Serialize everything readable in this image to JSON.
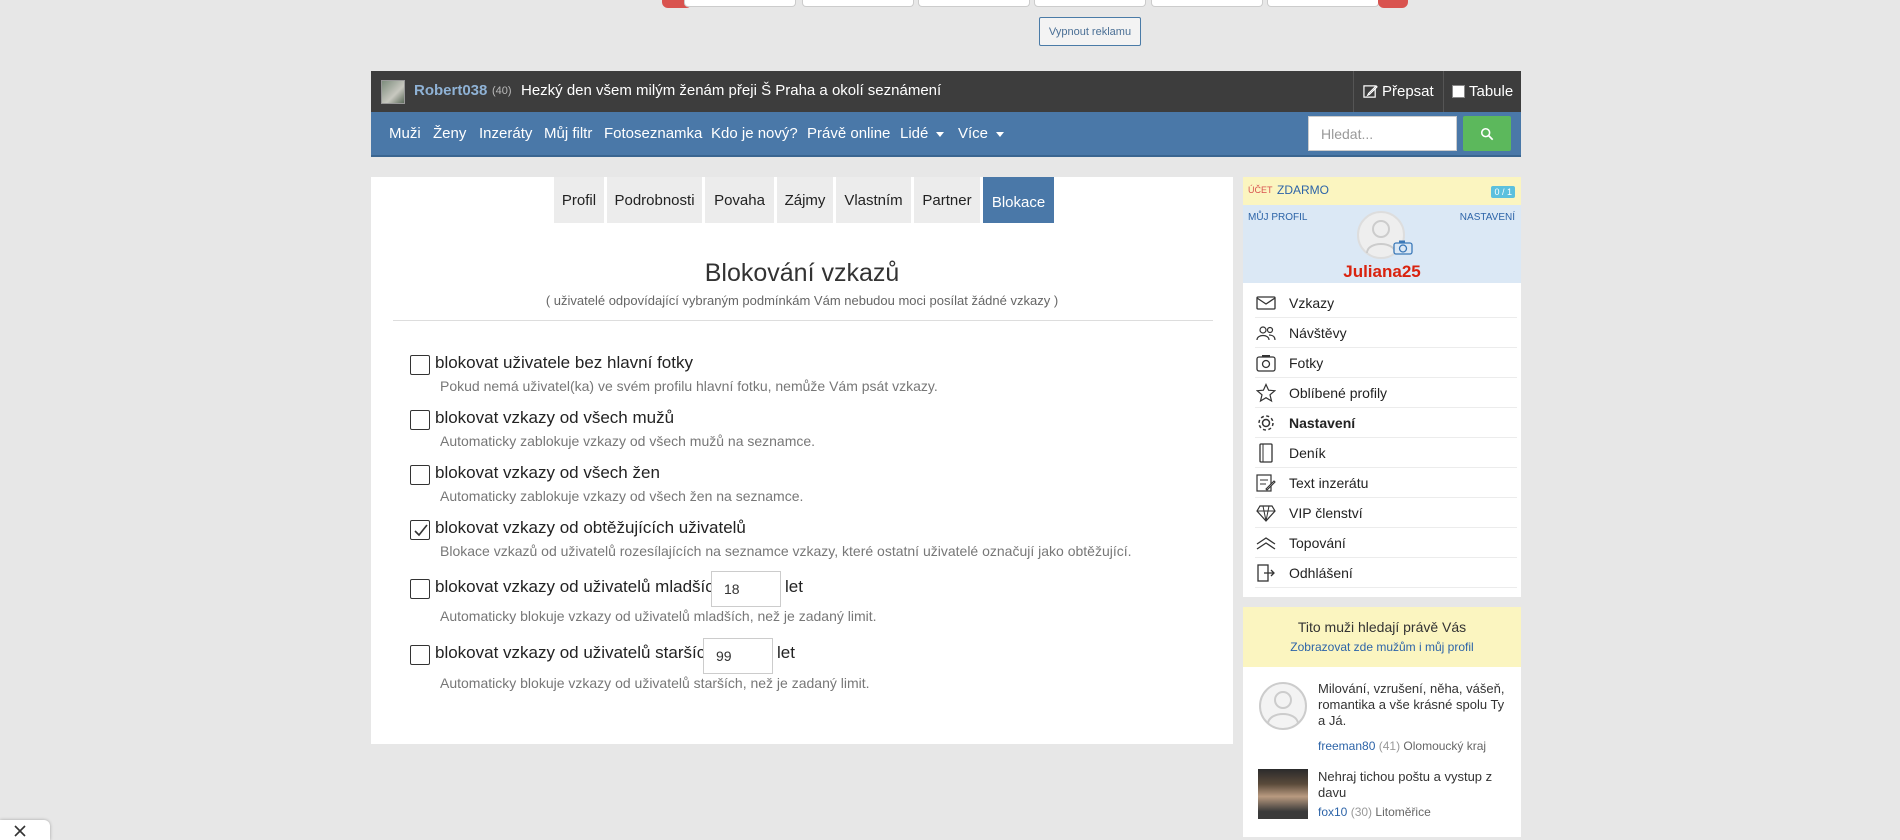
{
  "ad": {
    "button_label": "Vypnout reklamu"
  },
  "header": {
    "username": "Robert038",
    "age": "(40)",
    "status_message": "Hezký den všem milým ženám přeji Š Praha a okolí seznámení",
    "rewrite_label": "Přepsat",
    "board_label": "Tabule"
  },
  "nav": {
    "items": [
      "Muži",
      "Ženy",
      "Inzeráty",
      "Můj filtr",
      "Fotoseznamka",
      "Kdo je nový?",
      "Právě online",
      "Lidé",
      "Více"
    ],
    "search_placeholder": "Hledat..."
  },
  "tabs": [
    "Profil",
    "Podrobnosti",
    "Povaha",
    "Zájmy",
    "Vlastním",
    "Partner",
    "Blokace"
  ],
  "active_tab": "Blokace",
  "page": {
    "title": "Blokování vzkazů",
    "subtitle": "( uživatelé odpovídající vybraným podmínkám Vám nebudou moci posílat žádné vzkazy )"
  },
  "options": [
    {
      "label": "blokovat uživatele bez hlavní fotky",
      "desc": "Pokud nemá uživatel(ka) ve svém profilu hlavní fotku, nemůže Vám psát vzkazy.",
      "checked": false
    },
    {
      "label": "blokovat vzkazy od všech mužů",
      "desc": "Automaticky zablokuje vzkazy od všech mužů na seznamce.",
      "checked": false
    },
    {
      "label": "blokovat vzkazy od všech žen",
      "desc": "Automaticky zablokuje vzkazy od všech žen na seznamce.",
      "checked": false
    },
    {
      "label": "blokovat vzkazy od obtěžujících uživatelů",
      "desc": "Blokace vzkazů od uživatelů rozesílajících na seznamce vzkazy, které ostatní uživatelé označují jako obtěžující.",
      "checked": true
    },
    {
      "label": "blokovat vzkazy od uživatelů mladších",
      "desc": "Automaticky blokuje vzkazy od uživatelů mladších, než je zadaný limit.",
      "checked": false,
      "value": "18",
      "unit": "let"
    },
    {
      "label": "blokovat vzkazy od uživatelů starších",
      "desc": "Automaticky blokuje vzkazy od uživatelů starších, než je zadaný limit.",
      "checked": false,
      "value": "99",
      "unit": "let"
    }
  ],
  "sidebar": {
    "account_label": "ÚČET",
    "account_type": "ZDARMO",
    "badge": "0 / 1",
    "my_profile": "MŮJ PROFIL",
    "settings": "NASTAVENÍ",
    "profile_name": "Juliana25",
    "menu": [
      {
        "label": "Vzkazy",
        "icon": "envelope-icon"
      },
      {
        "label": "Návštěvy",
        "icon": "visitors-icon"
      },
      {
        "label": "Fotky",
        "icon": "photos-icon"
      },
      {
        "label": "Oblíbené profily",
        "icon": "star-icon"
      },
      {
        "label": "Nastavení",
        "icon": "gear-icon",
        "bold": true
      },
      {
        "label": "Deník",
        "icon": "diary-icon"
      },
      {
        "label": "Text inzerátu",
        "icon": "edit-text-icon"
      },
      {
        "label": "VIP členství",
        "icon": "diamond-icon"
      },
      {
        "label": "Topování",
        "icon": "top-icon"
      },
      {
        "label": "Odhlášení",
        "icon": "logout-icon"
      }
    ]
  },
  "looking": {
    "title": "Tito muži hledají právě Vás",
    "link": "Zobrazovat zde mužům i můj profil",
    "entries": [
      {
        "message": "Milování, vzrušení, něha, vášeň, romantika a vše krásné spolu Ty a Já.",
        "nick": "freeman80",
        "age": "(41)",
        "place": "Olomoucký kraj"
      },
      {
        "message": "Nehraj tichou poštu a vystup z davu",
        "nick": "fox10",
        "age": "(30)",
        "place": "Litoměřice"
      }
    ]
  }
}
